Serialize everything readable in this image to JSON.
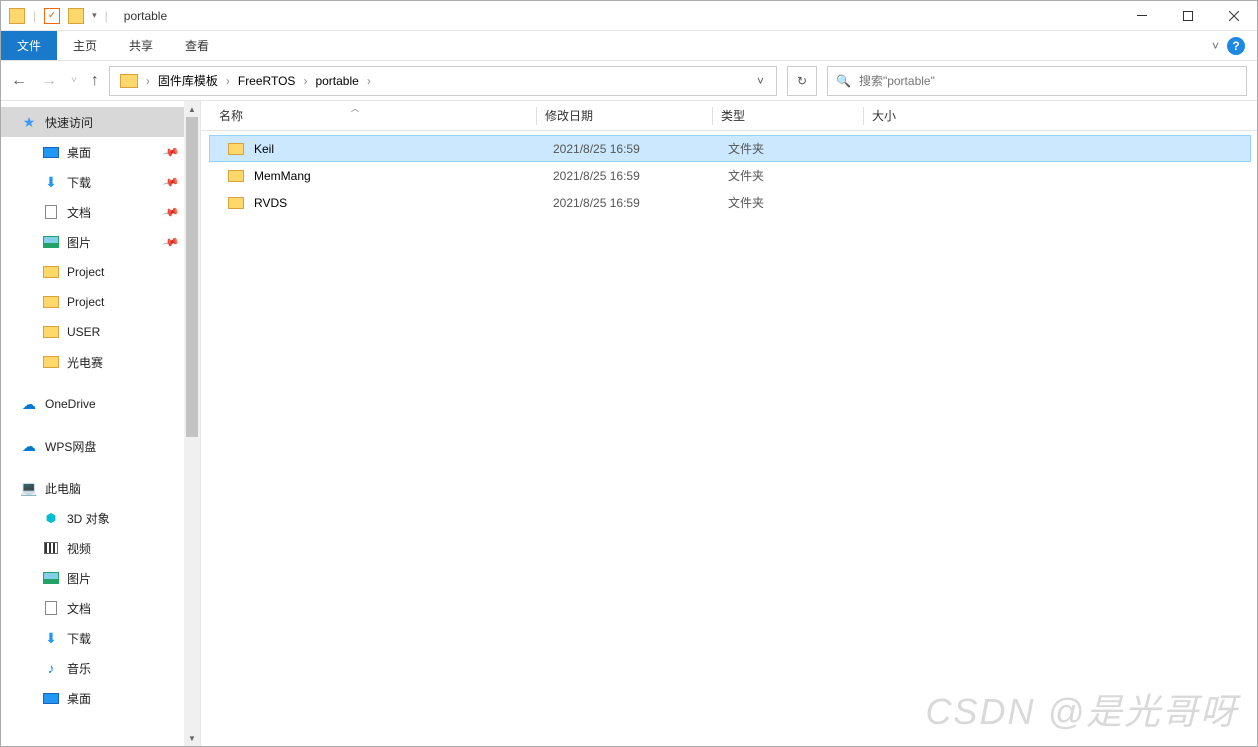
{
  "title": "portable",
  "ribbon": {
    "tabs": [
      "文件",
      "主页",
      "共享",
      "查看"
    ]
  },
  "breadcrumb": [
    "固件库模板",
    "FreeRTOS",
    "portable"
  ],
  "search_placeholder": "搜索\"portable\"",
  "columns": {
    "name": "名称",
    "date": "修改日期",
    "type": "类型",
    "size": "大小"
  },
  "files": [
    {
      "name": "Keil",
      "date": "2021/8/25 16:59",
      "type": "文件夹",
      "selected": true
    },
    {
      "name": "MemMang",
      "date": "2021/8/25 16:59",
      "type": "文件夹",
      "selected": false
    },
    {
      "name": "RVDS",
      "date": "2021/8/25 16:59",
      "type": "文件夹",
      "selected": false
    }
  ],
  "sidebar": {
    "quick_access": "快速访问",
    "quick_items": [
      {
        "label": "桌面",
        "icon": "desktop",
        "pinned": true
      },
      {
        "label": "下载",
        "icon": "download",
        "pinned": true
      },
      {
        "label": "文档",
        "icon": "doc",
        "pinned": true
      },
      {
        "label": "图片",
        "icon": "pic",
        "pinned": true
      },
      {
        "label": "Project",
        "icon": "folder",
        "pinned": false
      },
      {
        "label": "Project",
        "icon": "folder",
        "pinned": false
      },
      {
        "label": "USER",
        "icon": "folder",
        "pinned": false
      },
      {
        "label": "光电赛",
        "icon": "folder",
        "pinned": false
      }
    ],
    "onedrive": "OneDrive",
    "wps": "WPS网盘",
    "this_pc": "此电脑",
    "pc_items": [
      {
        "label": "3D 对象",
        "icon": "3d"
      },
      {
        "label": "视频",
        "icon": "video"
      },
      {
        "label": "图片",
        "icon": "pic"
      },
      {
        "label": "文档",
        "icon": "doc"
      },
      {
        "label": "下载",
        "icon": "download"
      },
      {
        "label": "音乐",
        "icon": "music"
      },
      {
        "label": "桌面",
        "icon": "desktop"
      }
    ]
  },
  "watermark": "CSDN @是光哥呀"
}
